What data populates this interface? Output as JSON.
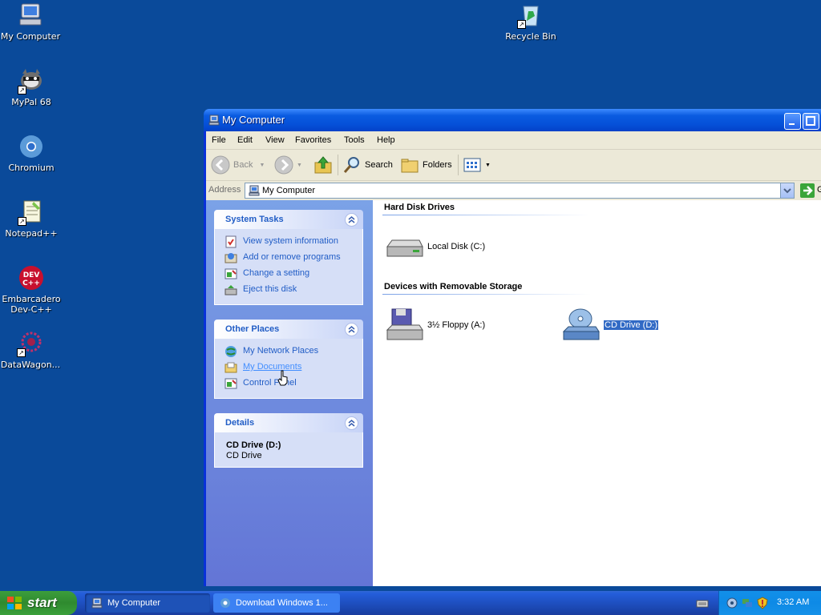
{
  "desktop": {
    "icons": [
      {
        "label": "My Computer"
      },
      {
        "label": "MyPal 68"
      },
      {
        "label": "Chromium"
      },
      {
        "label": "Notepad++"
      },
      {
        "label": "Embarcadero Dev-C++"
      },
      {
        "label": "DataWagon..."
      },
      {
        "label": "Recycle Bin"
      }
    ]
  },
  "window": {
    "title": "My Computer",
    "menu": [
      "File",
      "Edit",
      "View",
      "Favorites",
      "Tools",
      "Help"
    ],
    "toolbar": {
      "back": "Back",
      "search": "Search",
      "folders": "Folders"
    },
    "address": {
      "label": "Address",
      "value": "My Computer",
      "go": "G"
    },
    "taskpane": {
      "system_tasks": {
        "title": "System Tasks",
        "items": [
          "View system information",
          "Add or remove programs",
          "Change a setting",
          "Eject this disk"
        ]
      },
      "other_places": {
        "title": "Other Places",
        "items": [
          "My Network Places",
          "My Documents",
          "Control Panel"
        ]
      },
      "details": {
        "title": "Details",
        "name": "CD Drive (D:)",
        "type": "CD Drive"
      }
    },
    "content": {
      "hard_disk_title": "Hard Disk Drives",
      "local_disk": "Local Disk (C:)",
      "removable_title": "Devices with Removable Storage",
      "floppy": "3½ Floppy (A:)",
      "cd_drive": "CD Drive (D:)"
    }
  },
  "taskbar": {
    "start": "start",
    "tasks": [
      "My Computer",
      "Download Windows 1..."
    ],
    "clock": "3:32 AM"
  },
  "colors": {
    "desktop": "#0a4a9a",
    "taskpane_link": "#215dc6",
    "selection": "#316ac5"
  }
}
